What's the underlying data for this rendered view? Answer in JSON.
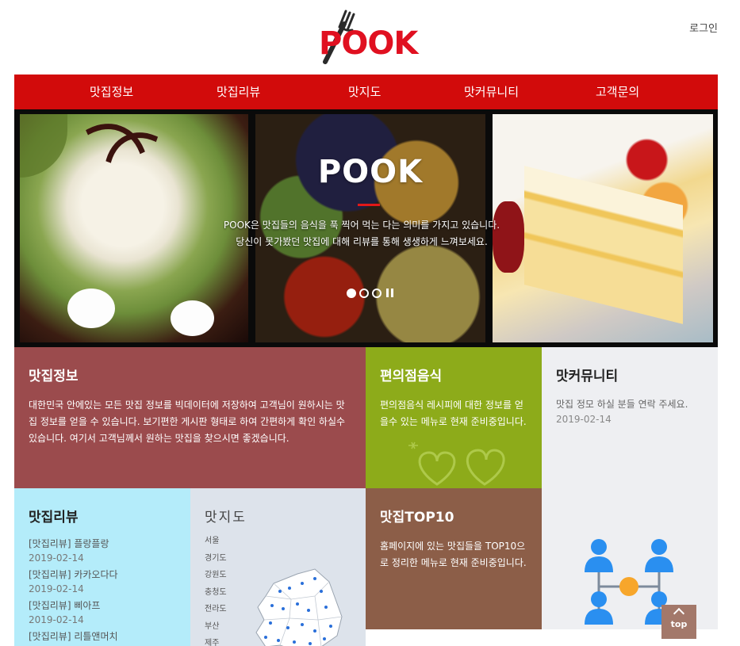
{
  "header": {
    "logo_text": "POOK",
    "login": "로그인"
  },
  "nav": {
    "items": [
      "맛집정보",
      "맛집리뷰",
      "맛지도",
      "맛커뮤니티",
      "고객문의"
    ]
  },
  "hero": {
    "title": "POOK",
    "desc_line1": "POOK은 맛집들의 음식을 푹 찍어 먹는 다는 의미를 가지고 있습니다.",
    "desc_line2": "당신이 못가봤던 맛집에 대해 리뷰를 통해 생생하게 느껴보세요."
  },
  "tiles": {
    "info": {
      "title": "맛집정보",
      "text": "대한민국 안에있는 모든 맛집 정보를 빅데이터에 저장하여 고객님이 원하시는 맛집 정보를 얻을 수 있습니다. 보기편한 게시판 형태로 하여 간편하게 확인 하실수 있습니다. 여기서 고객님께서 원하는 맛집을 찾으시면 좋겠습니다."
    },
    "convenience": {
      "title": "편의점음식",
      "text": "편의점음식 레시피에 대한 정보를 얻을수 있는 메뉴로 현재 준비중입니다."
    },
    "community": {
      "title": "맛커뮤니티",
      "post": "맛집 정모 하실 분들 연락 주세요.",
      "date": "2019-02-14"
    },
    "review": {
      "title": "맛집리뷰",
      "items": [
        {
          "label": "[맛집리뷰] 플랑플랑",
          "date": "2019-02-14"
        },
        {
          "label": "[맛집리뷰] 카카오다다",
          "date": "2019-02-14"
        },
        {
          "label": "[맛집리뷰] 삐아프",
          "date": "2019-02-14"
        },
        {
          "label": "[맛집리뷰] 리틀앤머치",
          "date": ""
        }
      ]
    },
    "map": {
      "title": "맛지도",
      "regions": [
        "서울",
        "경기도",
        "강원도",
        "충청도",
        "전라도",
        "부산",
        "제주"
      ]
    },
    "top10": {
      "title": "맛집TOP10",
      "text": "홈페이지에 있는 맛집들을 TOP10으로 정리한 메뉴로 현재 준비중입니다."
    }
  },
  "top_button": "top",
  "colors": {
    "brand_red": "#d20b0b",
    "info_bg": "#9b4b4d",
    "convenience_bg": "#8dab1a",
    "community_bg": "#eeeff2",
    "review_bg": "#b4ecfa",
    "map_bg": "#dde3eb",
    "top10_bg": "#8c5e48"
  }
}
